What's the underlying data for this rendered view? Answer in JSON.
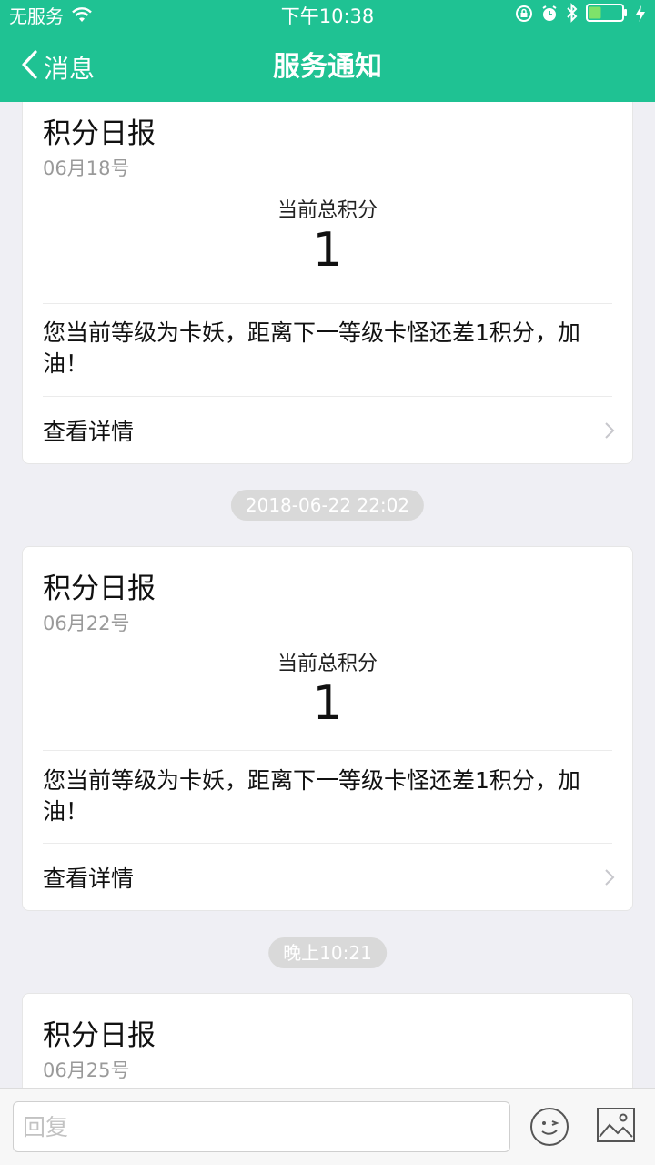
{
  "status_bar": {
    "carrier": "无服务",
    "time": "下午10:38",
    "icons": [
      "wifi-icon",
      "rotation-lock-icon",
      "alarm-icon",
      "bluetooth-icon",
      "battery-icon",
      "charging-icon"
    ]
  },
  "nav": {
    "back_label": "消息",
    "title": "服务通知"
  },
  "colors": {
    "accent": "#1fc293",
    "background": "#efeff4"
  },
  "cards": [
    {
      "title": "积分日报",
      "date": "06月18号",
      "score_label": "当前总积分",
      "score_value": "1",
      "description": "您当前等级为卡妖，距离下一等级卡怪还差1积分，加油！",
      "details_label": "查看详情"
    },
    {
      "title": "积分日报",
      "date": "06月22号",
      "score_label": "当前总积分",
      "score_value": "1",
      "description": "您当前等级为卡妖，距离下一等级卡怪还差1积分，加油！",
      "details_label": "查看详情"
    },
    {
      "title": "积分日报",
      "date": "06月25号"
    }
  ],
  "timestamps": [
    "2018-06-22 22:02",
    "晚上10:21"
  ],
  "input": {
    "placeholder": "回复",
    "value": ""
  },
  "bottom_icons": [
    "emoji-icon",
    "image-icon"
  ]
}
